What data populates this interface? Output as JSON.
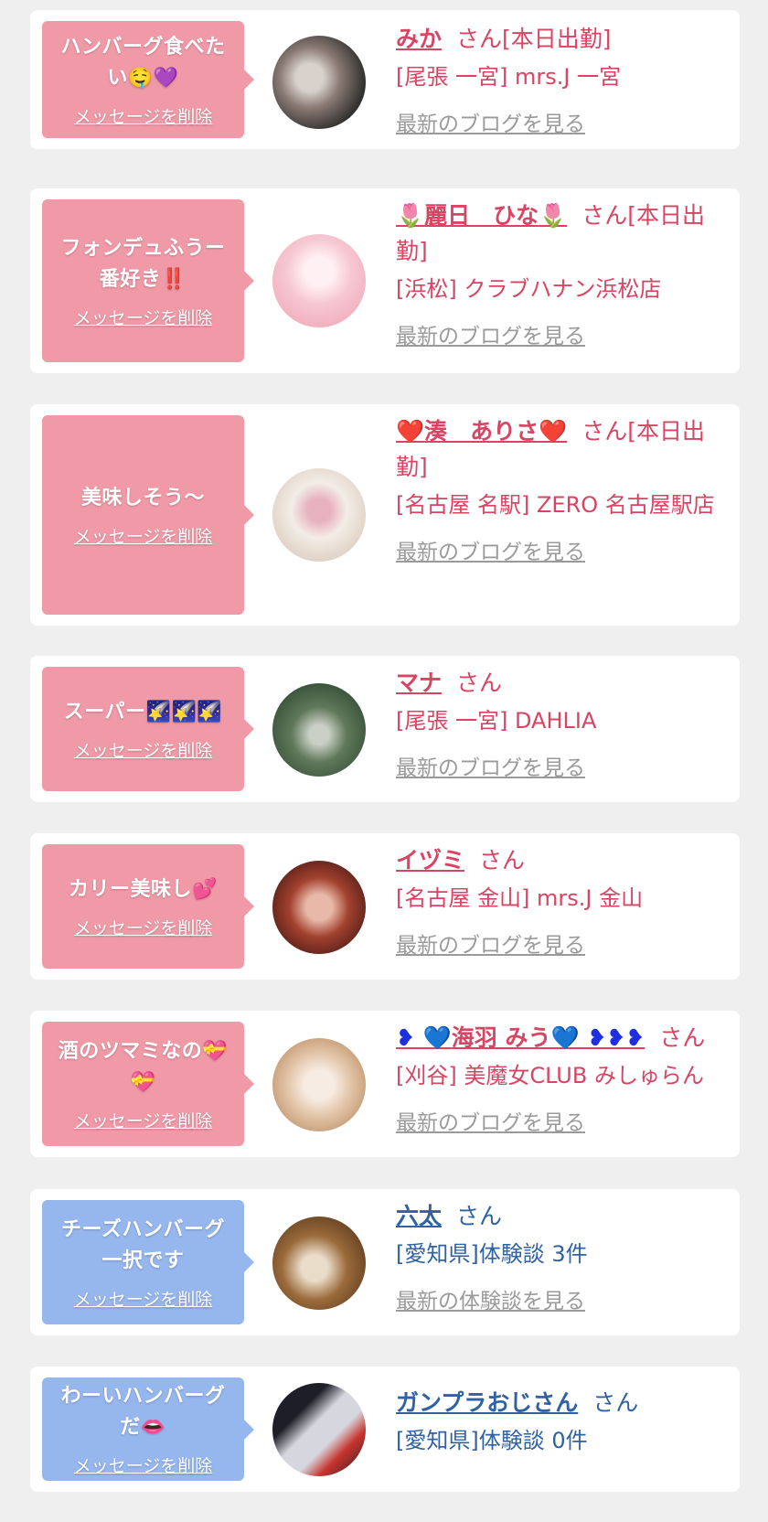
{
  "items": [
    {
      "bubble_text": "ハンバーグ食べたい🤤💜",
      "delete_label": "メッセージを削除",
      "name": "みか",
      "honorific": "さん[本日出勤]",
      "shop": "[尾張 一宮] mrs.J 一宮",
      "link": "最新のブログを見る",
      "avatar_icon": "woman-with-cat-photo",
      "avatar_colors": [
        "#2c2c2c",
        "#8a7a74",
        "#d9d2cc"
      ]
    },
    {
      "bubble_text": "フォンデュふうー番好き‼️",
      "delete_label": "メッセージを削除",
      "name_prefix": "🌷",
      "name": "麗日　ひな",
      "name_suffix": "🌷",
      "honorific": "さん[本日出勤]",
      "shop": "[浜松] クラブハナン浜松店",
      "link": "最新のブログを見る",
      "avatar_icon": "woman-in-pink-dress-photo",
      "avatar_colors": [
        "#f6c7d2",
        "#f2aebc",
        "#fff0f3"
      ]
    },
    {
      "bubble_text": "美味しそう〜",
      "delete_label": "メッセージを削除",
      "name_prefix": "❤️",
      "name": "湊　ありさ",
      "name_suffix": "❤️",
      "honorific": "さん[本日出勤]",
      "shop": "[名古屋 名駅] ZERO 名古屋駅店",
      "link": "最新のブログを見る",
      "avatar_icon": "woman-with-flowers-photo",
      "avatar_colors": [
        "#f3ede6",
        "#d9c9bb",
        "#e7b1bd"
      ]
    },
    {
      "bubble_text": "スーパー🌠🌠🌠",
      "delete_label": "メッセージを削除",
      "name": "マナ",
      "honorific": "さん",
      "shop": "[尾張 一宮] DAHLIA",
      "link": "最新のブログを見る",
      "avatar_icon": "woman-in-forest-photo",
      "avatar_colors": [
        "#2f4a34",
        "#60785a",
        "#c9cfc5"
      ]
    },
    {
      "bubble_text": "カリー美味し💕",
      "delete_label": "メッセージを削除",
      "name": "イヅミ",
      "honorific": "さん",
      "shop": "[名古屋 金山] mrs.J 金山",
      "link": "最新のブログを見る",
      "avatar_icon": "red-haired-woman-photo",
      "avatar_colors": [
        "#4a1a14",
        "#a3412f",
        "#e8b8a8"
      ]
    },
    {
      "bubble_text": "酒のツマミなの💝💝",
      "delete_label": "メッセージを削除",
      "name_prefix": "❥ 💙",
      "name": "海羽 みう",
      "name_suffix": "💙 ❥❥❥",
      "honorific": "さん",
      "shop": "[刈谷] 美魔女CLUB みしゅらん",
      "link": "最新のブログを見る",
      "avatar_icon": "blonde-woman-photo",
      "avatar_colors": [
        "#b88a62",
        "#e1c2a4",
        "#f7ece4"
      ]
    },
    {
      "bubble_text": "チーズハンバーグ一択です",
      "delete_label": "メッセージを削除",
      "name": "六太",
      "honorific": "さん",
      "shop": "[愛知県]体験談 3件",
      "link": "最新の体験談を見る",
      "avatar_icon": "food-plate-photo",
      "avatar_colors": [
        "#5b3a1e",
        "#9a6a3a",
        "#e9dcc8"
      ]
    },
    {
      "bubble_text": "わーいハンバーグだ👄",
      "delete_label": "メッセージを削除",
      "name": "ガンプラおじさん",
      "honorific": "さん",
      "shop": "[愛知県]体験談 0件",
      "link": "",
      "avatar_icon": "gundam-model-photo",
      "avatar_colors": [
        "#1e1e28",
        "#d6d6de",
        "#c8342c"
      ]
    }
  ]
}
